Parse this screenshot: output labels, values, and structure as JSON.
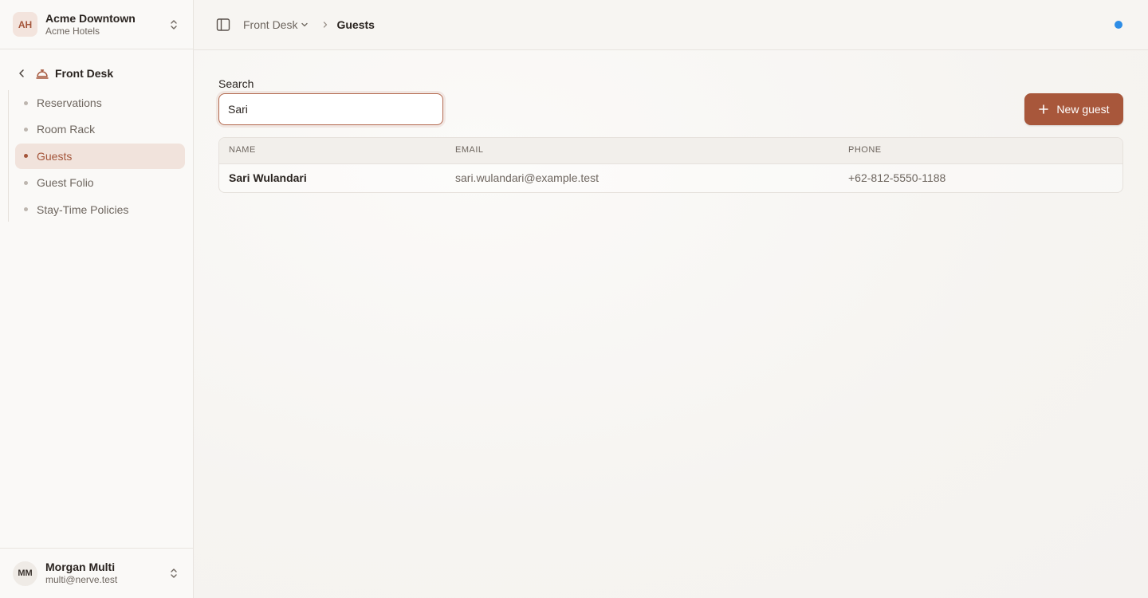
{
  "org": {
    "initials": "AH",
    "name": "Acme Downtown",
    "subtitle": "Acme Hotels"
  },
  "section": {
    "title": "Front Desk"
  },
  "nav": {
    "items": [
      {
        "label": "Reservations",
        "active": false
      },
      {
        "label": "Room Rack",
        "active": false
      },
      {
        "label": "Guests",
        "active": true
      },
      {
        "label": "Guest Folio",
        "active": false
      },
      {
        "label": "Stay-Time Policies",
        "active": false
      }
    ]
  },
  "user": {
    "initials": "MM",
    "name": "Morgan Multi",
    "email": "multi@nerve.test"
  },
  "breadcrumb": {
    "parent": "Front Desk",
    "current": "Guests"
  },
  "search": {
    "label": "Search",
    "value": "Sari"
  },
  "actions": {
    "new_guest_label": "New guest"
  },
  "table": {
    "columns": [
      "NAME",
      "EMAIL",
      "PHONE"
    ],
    "rows": [
      {
        "name": "Sari Wulandari",
        "email": "sari.wulandari@example.test",
        "phone": "+62-812-5550-1188"
      }
    ]
  },
  "colors": {
    "accent": "#a8573b",
    "status_dot": "#2e8de6",
    "active_nav_bg": "#f1e3dc"
  }
}
